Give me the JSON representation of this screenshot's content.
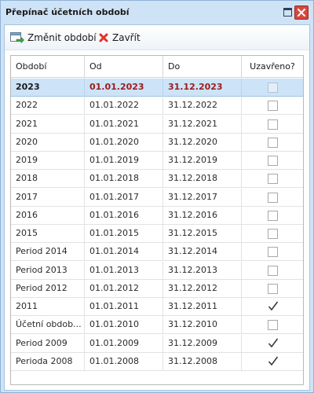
{
  "window": {
    "title": "Přepínač účetních období"
  },
  "toolbar": {
    "change_label": "Změnit období",
    "close_label": "Zavřít"
  },
  "table": {
    "columns": [
      "Období",
      "Od",
      "Do",
      "Uzavřeno?"
    ],
    "rows": [
      {
        "period": "2023",
        "from": "01.01.2023",
        "to": "31.12.2023",
        "closed": false,
        "selected": true
      },
      {
        "period": "2022",
        "from": "01.01.2022",
        "to": "31.12.2022",
        "closed": false
      },
      {
        "period": "2021",
        "from": "01.01.2021",
        "to": "31.12.2021",
        "closed": false
      },
      {
        "period": "2020",
        "from": "01.01.2020",
        "to": "31.12.2020",
        "closed": false
      },
      {
        "period": "2019",
        "from": "01.01.2019",
        "to": "31.12.2019",
        "closed": false
      },
      {
        "period": "2018",
        "from": "01.01.2018",
        "to": "31.12.2018",
        "closed": false
      },
      {
        "period": "2017",
        "from": "01.01.2017",
        "to": "31.12.2017",
        "closed": false
      },
      {
        "period": "2016",
        "from": "01.01.2016",
        "to": "31.12.2016",
        "closed": false
      },
      {
        "period": "2015",
        "from": "01.01.2015",
        "to": "31.12.2015",
        "closed": false
      },
      {
        "period": "Period 2014",
        "from": "01.01.2014",
        "to": "31.12.2014",
        "closed": false
      },
      {
        "period": "Period 2013",
        "from": "01.01.2013",
        "to": "31.12.2013",
        "closed": false
      },
      {
        "period": "Period 2012",
        "from": "01.01.2012",
        "to": "31.12.2012",
        "closed": false
      },
      {
        "period": "2011",
        "from": "01.01.2011",
        "to": "31.12.2011",
        "closed": true
      },
      {
        "period": "Účetní obdob...",
        "from": "01.01.2010",
        "to": "31.12.2010",
        "closed": false
      },
      {
        "period": "Period 2009",
        "from": "01.01.2009",
        "to": "31.12.2009",
        "closed": true
      },
      {
        "period": "Perioda 2008",
        "from": "01.01.2008",
        "to": "31.12.2008",
        "closed": true
      }
    ]
  },
  "colors": {
    "titlebar": "#cfe3f7",
    "selected_row": "#cde3f8",
    "selected_date_text": "#9c1b1b",
    "close_button": "#d9463b"
  },
  "icons": {
    "change": "window-arrow-icon",
    "close": "red-x-icon",
    "maximize": "maximize-icon",
    "window_close": "close-icon"
  }
}
